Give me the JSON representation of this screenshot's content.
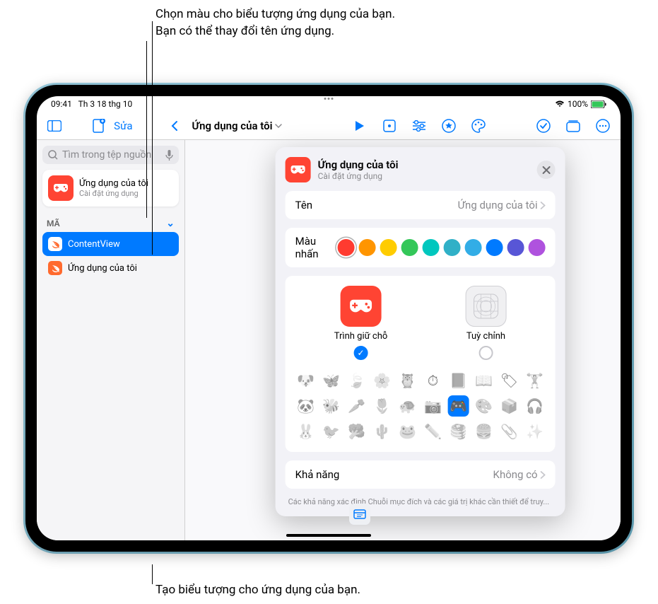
{
  "callouts": {
    "color": "Chọn màu cho biểu tượng ứng dụng của bạn.",
    "name": "Bạn có thể thay đổi tên ứng dụng.",
    "icon": "Tạo biểu tượng cho ứng dụng của bạn."
  },
  "status": {
    "time": "09:41",
    "date": "Th 3 18 thg 10",
    "battery": "100%"
  },
  "toolbar": {
    "edit": "Sửa",
    "title": "Ứng dụng của tôi"
  },
  "sidebar": {
    "search_placeholder": "Tìm trong tệp nguồn",
    "app_name": "Ứng dụng của tôi",
    "app_sub": "Cài đặt ứng dụng",
    "code_section": "MÃ",
    "files": [
      "ContentView",
      "Ứng dụng của tôi"
    ]
  },
  "modal": {
    "title": "Ứng dụng của tôi",
    "subtitle": "Cài đặt ứng dụng",
    "name_label": "Tên",
    "name_value": "Ứng dụng của tôi",
    "accent_label": "Màu nhấn",
    "placeholder_label": "Trình giữ chỗ",
    "custom_label": "Tuỳ chỉnh",
    "capability_label": "Khả năng",
    "capability_value": "Không có",
    "footer": "Các khả năng xác định Chuỗi mục đích và các giá trị khác cần thiết để truy..."
  },
  "colors": [
    {
      "hex": "#ff3b30",
      "selected": true
    },
    {
      "hex": "#ff9500",
      "selected": false
    },
    {
      "hex": "#ffcc00",
      "selected": false
    },
    {
      "hex": "#34c759",
      "selected": false
    },
    {
      "hex": "#00c7be",
      "selected": false
    },
    {
      "hex": "#30b0c7",
      "selected": false
    },
    {
      "hex": "#32ade6",
      "selected": false
    },
    {
      "hex": "#007aff",
      "selected": false
    },
    {
      "hex": "#5856d6",
      "selected": false
    },
    {
      "hex": "#af52de",
      "selected": false
    }
  ],
  "icon_grid": [
    "🐶",
    "🦋",
    "🍃",
    "🌸",
    "🦉",
    "⏱",
    "📕",
    "📖",
    "🏷",
    "🏋",
    "🐼",
    "🐝",
    "🥕",
    "🌷",
    "🐢",
    "📷",
    "🎮",
    "🎨",
    "📦",
    "🎧",
    "🐰",
    "🐦",
    "🥦",
    "🌵",
    "🐸",
    "✏️",
    "🥞",
    "🍔",
    "📎",
    "✨"
  ],
  "icon_selected_index": 16
}
